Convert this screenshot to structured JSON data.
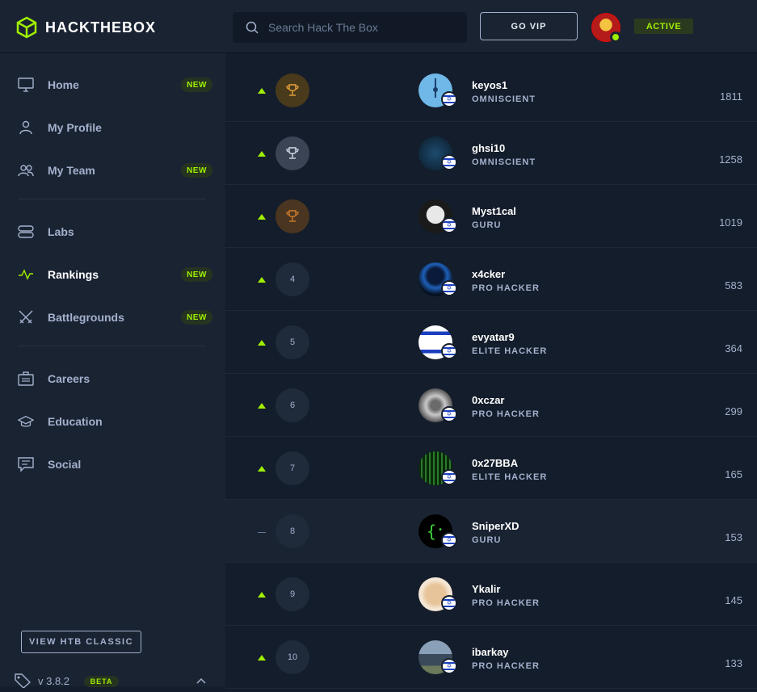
{
  "brand": {
    "name": "HACKTHEBOX",
    "accent": "#9fef00"
  },
  "search": {
    "placeholder": "Search Hack The Box"
  },
  "header": {
    "vip_label": "GO VIP",
    "status": "ACTIVE"
  },
  "sidebar": {
    "items": [
      {
        "label": "Home",
        "icon": "monitor-icon",
        "badge": "NEW"
      },
      {
        "label": "My Profile",
        "icon": "user-icon",
        "badge": ""
      },
      {
        "label": "My Team",
        "icon": "team-icon",
        "badge": "NEW"
      },
      {
        "label": "Labs",
        "icon": "server-icon",
        "badge": ""
      },
      {
        "label": "Rankings",
        "icon": "pulse-icon",
        "badge": "NEW"
      },
      {
        "label": "Battlegrounds",
        "icon": "swords-icon",
        "badge": "NEW"
      },
      {
        "label": "Careers",
        "icon": "briefcase-icon",
        "badge": ""
      },
      {
        "label": "Education",
        "icon": "graduation-cap-icon",
        "badge": ""
      },
      {
        "label": "Social",
        "icon": "chat-icon",
        "badge": ""
      }
    ],
    "classic_button": "VIEW HTB CLASSIC",
    "version": "v 3.8.2",
    "beta": "BETA"
  },
  "rankings": [
    {
      "position": "",
      "trophy": "gold",
      "trend": "up",
      "name": "keyos1",
      "rank": "OMNISCIENT",
      "score": "1811"
    },
    {
      "position": "",
      "trophy": "silver",
      "trend": "up",
      "name": "ghsi10",
      "rank": "OMNISCIENT",
      "score": "1258"
    },
    {
      "position": "",
      "trophy": "bronze",
      "trend": "up",
      "name": "Myst1cal",
      "rank": "GURU",
      "score": "1019"
    },
    {
      "position": "4",
      "trophy": "",
      "trend": "up",
      "name": "x4cker",
      "rank": "PRO HACKER",
      "score": "583"
    },
    {
      "position": "5",
      "trophy": "",
      "trend": "up",
      "name": "evyatar9",
      "rank": "ELITE HACKER",
      "score": "364"
    },
    {
      "position": "6",
      "trophy": "",
      "trend": "up",
      "name": "0xczar",
      "rank": "PRO HACKER",
      "score": "299"
    },
    {
      "position": "7",
      "trophy": "",
      "trend": "up",
      "name": "0x27BBA",
      "rank": "ELITE HACKER",
      "score": "165"
    },
    {
      "position": "8",
      "trophy": "",
      "trend": "flat",
      "name": "SniperXD",
      "rank": "GURU",
      "score": "153"
    },
    {
      "position": "9",
      "trophy": "",
      "trend": "up",
      "name": "Ykalir",
      "rank": "PRO HACKER",
      "score": "145"
    },
    {
      "position": "10",
      "trophy": "",
      "trend": "up",
      "name": "ibarkay",
      "rank": "PRO HACKER",
      "score": "133"
    }
  ]
}
